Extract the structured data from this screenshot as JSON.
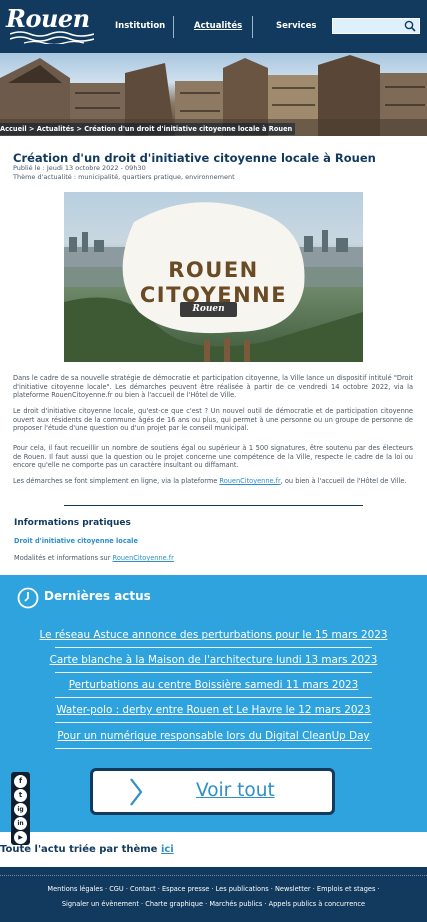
{
  "header": {
    "logo_text": "Rouen",
    "nav": [
      "Institution",
      "Actualités",
      "Services"
    ],
    "search_value": ""
  },
  "breadcrumb": "Accueil > Actualités > Création d'un droit d'initiative citoyenne locale à Rouen",
  "article": {
    "title": "Création d'un droit d'initiative citoyenne locale à Rouen",
    "date": "Publié le : Jeudi 13 octobre 2022 - 09h30",
    "theme": "Thème d'actualité : municipalité, quartiers pratique, environnement",
    "image_text_1": "ROUEN",
    "image_text_2": "CITOYENNE",
    "image_logo": "Rouen",
    "para1": "Dans le cadre de sa nouvelle stratégie de démocratie et participation citoyenne, la Ville lance un dispositif intitulé \"Droit d'initiative citoyenne locale\". Les démarches peuvent être réalisée à partir de ce vendredi 14 octobre 2022, via la plateforme RouenCitoyenne.fr ou bien à l'accueil de l'Hôtel de Ville.",
    "para2": "Le droit d'initiative citoyenne locale, qu'est-ce que c'est ? Un nouvel outil de démocratie et de participation citoyenne ouvert aux résidents de la commune âgés de 16 ans ou plus, qui permet à une personne ou un groupe de personne de proposer l'étude d'une question ou d'un projet par le conseil municipal.",
    "para3": "Pour cela, il faut recueillir un nombre de soutiens égal ou supérieur à 1 500 signatures, être soutenu par des électeurs de Rouen. Il faut aussi que la question ou le projet concerne une compétence de la Ville, respecte le cadre de la loi ou encore qu'elle ne comporte pas un caractère insultant ou diffamant.",
    "para4_before": "Les démarches se font simplement en ligne, via la plateforme ",
    "para4_link": "RouenCitoyenne.fr",
    "para4_after": ", ou bien à l'accueil de l'Hôtel de Ville."
  },
  "info": {
    "heading": "Informations pratiques",
    "link_title": "Droit d'initiative citoyenne locale",
    "modalites_before": "Modalités et informations sur ",
    "modalites_link": "RouenCitoyenne.fr"
  },
  "news": {
    "heading": "Dernières actus",
    "items": [
      "Le réseau Astuce annonce des perturbations pour le 15 mars 2023",
      "Carte blanche à la Maison de l'architecture lundi 13 mars 2023",
      "Perturbations au centre Boissière samedi 11 mars 2023",
      "Water-polo : derby entre Rouen et Le Havre le 12 mars 2023",
      "Pour un numérique responsable lors du Digital CleanUp Day"
    ],
    "voir_tout": "Voir tout",
    "social": [
      "f",
      "t",
      "ig",
      "in",
      "▶"
    ]
  },
  "all_news": {
    "text": "Toute l'actu triée par thème ",
    "link": "ici"
  },
  "footer": {
    "line1": "Mentions légales · CGU · Contact · Espace presse · Les publications · Newsletter · Emplois et stages ·",
    "line2": "Signaler un évènement · Charte graphique · Marchés publics · Appels publics à concurrence"
  },
  "colors": {
    "navy": "#123a5e",
    "accent_blue": "#2ea3dd",
    "link_blue": "#2c8fc9"
  }
}
